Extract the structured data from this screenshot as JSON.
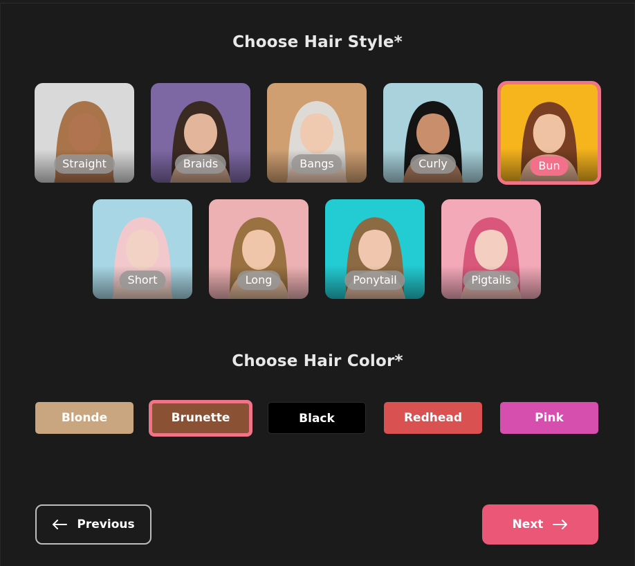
{
  "hair_style": {
    "title": "Choose Hair Style*",
    "selected": "Bun",
    "options": [
      {
        "label": "Straight",
        "bg": "#d9d9da",
        "hair": "#a9744a",
        "skin": "#b07450"
      },
      {
        "label": "Braids",
        "bg": "#7e68a4",
        "hair": "#3b2a22",
        "skin": "#e3b59a"
      },
      {
        "label": "Bangs",
        "bg": "#cf9f72",
        "hair": "#dedad6",
        "skin": "#efc9b0"
      },
      {
        "label": "Curly",
        "bg": "#a9d2dc",
        "hair": "#141414",
        "skin": "#c98f6c"
      },
      {
        "label": "Bun",
        "bg": "#f7b51d",
        "hair": "#7a3f22",
        "skin": "#f0c2a4"
      },
      {
        "label": "Short",
        "bg": "#a8d6e4",
        "hair": "#f2c8cd",
        "skin": "#f1d2c4"
      },
      {
        "label": "Long",
        "bg": "#eeb1b3",
        "hair": "#9a7242",
        "skin": "#efc6a9"
      },
      {
        "label": "Ponytail",
        "bg": "#23cbd3",
        "hair": "#8c6a44",
        "skin": "#f0c6ae"
      },
      {
        "label": "Pigtails",
        "bg": "#f4a9b8",
        "hair": "#d9577a",
        "skin": "#f4cfc1"
      }
    ]
  },
  "hair_color": {
    "title": "Choose Hair Color*",
    "selected": "Brunette",
    "options": [
      {
        "label": "Blonde",
        "color": "#c9a67f"
      },
      {
        "label": "Brunette",
        "color": "#8a5134"
      },
      {
        "label": "Black",
        "color": "#000000"
      },
      {
        "label": "Redhead",
        "color": "#d95150"
      },
      {
        "label": "Pink",
        "color": "#d74fae"
      }
    ]
  },
  "nav": {
    "previous_label": "Previous",
    "next_label": "Next",
    "next_color": "#ea5777"
  }
}
